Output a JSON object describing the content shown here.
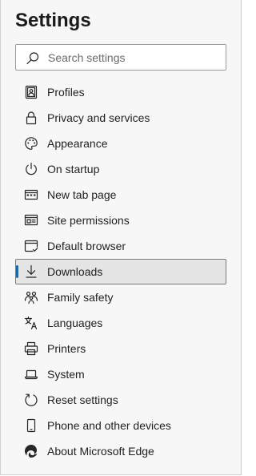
{
  "header": {
    "title": "Settings"
  },
  "search": {
    "placeholder": "Search settings"
  },
  "nav": {
    "selected": "Downloads",
    "items": [
      {
        "label": "Profiles",
        "icon": "profile-icon"
      },
      {
        "label": "Privacy and services",
        "icon": "lock-icon"
      },
      {
        "label": "Appearance",
        "icon": "palette-icon"
      },
      {
        "label": "On startup",
        "icon": "power-icon"
      },
      {
        "label": "New tab page",
        "icon": "new-tab-icon"
      },
      {
        "label": "Site permissions",
        "icon": "site-permissions-icon"
      },
      {
        "label": "Default browser",
        "icon": "default-browser-icon"
      },
      {
        "label": "Downloads",
        "icon": "download-icon"
      },
      {
        "label": "Family safety",
        "icon": "family-icon"
      },
      {
        "label": "Languages",
        "icon": "languages-icon"
      },
      {
        "label": "Printers",
        "icon": "printer-icon"
      },
      {
        "label": "System",
        "icon": "laptop-icon"
      },
      {
        "label": "Reset settings",
        "icon": "reset-icon"
      },
      {
        "label": "Phone and other devices",
        "icon": "phone-icon"
      },
      {
        "label": "About Microsoft Edge",
        "icon": "edge-logo-icon"
      }
    ]
  },
  "colors": {
    "accent": "#0f6cbd",
    "panel_bg": "#f7f7f7",
    "selected_bg": "#e5e5e5"
  }
}
